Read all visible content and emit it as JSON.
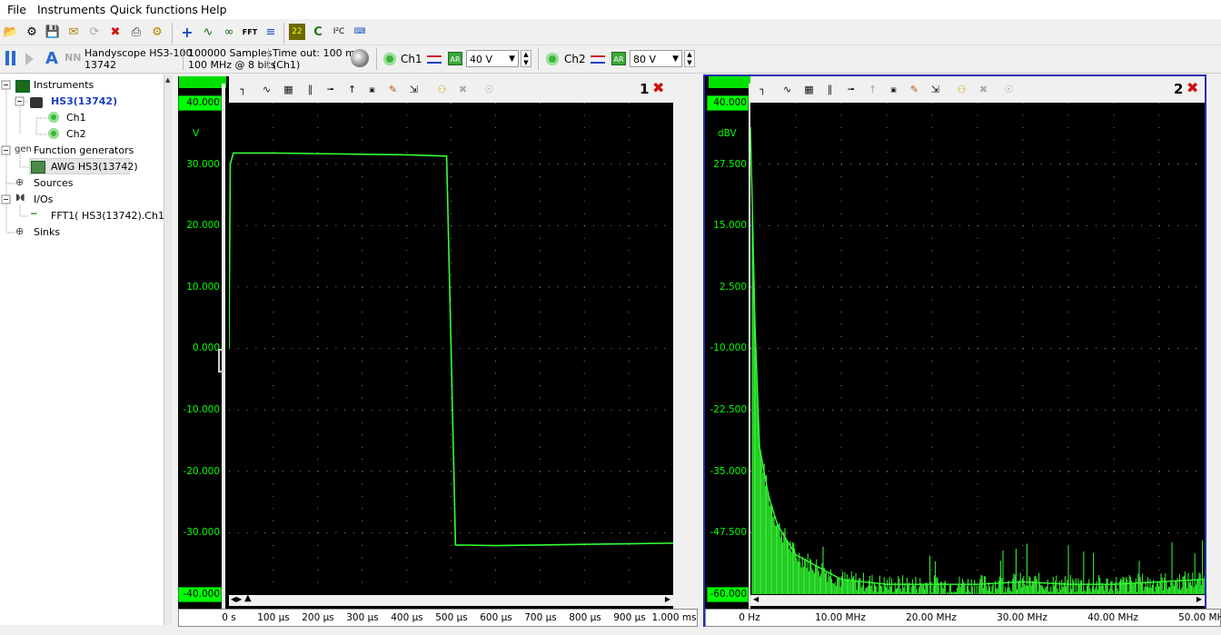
{
  "menu": [
    "File",
    "Instruments",
    "Quick functions",
    "Help"
  ],
  "instrument": {
    "name": "Handyscope HS3-100",
    "serial": "13742",
    "samples": "100000 Samples",
    "rate": "100 MHz @ 8 bits",
    "timeout": "Time out: 100 ms",
    "timeout_ch": "(Ch1)"
  },
  "ch1": {
    "label": "Ch1",
    "range": "40 V",
    "ar": "AR"
  },
  "ch2": {
    "label": "Ch2",
    "range": "80 V",
    "ar": "AR"
  },
  "tree": {
    "instruments": "Instruments",
    "device": "HS3(13742)",
    "ch1": "Ch1",
    "ch2": "Ch2",
    "funcgen": "Function generators",
    "awg": "AWG HS3(13742)",
    "sources": "Sources",
    "ios": "I/Os",
    "fft": "FFT1( HS3(13742).Ch1 )",
    "sinks": "Sinks"
  },
  "panel1": {
    "number": "1",
    "unit": "V",
    "yticks": [
      "40.000",
      "30.000",
      "20.000",
      "10.000",
      "0.000",
      "-10.000",
      "-20.000",
      "-30.000",
      "-40.000"
    ],
    "xticks": [
      "0 s",
      "100 µs",
      "200 µs",
      "300 µs",
      "400 µs",
      "500 µs",
      "600 µs",
      "700 µs",
      "800 µs",
      "900 µs",
      "1.000 ms"
    ]
  },
  "panel2": {
    "number": "2",
    "unit": "dBV",
    "yticks": [
      "40.000",
      "27.500",
      "15.000",
      "2.500",
      "-10.000",
      "-22.500",
      "-35.000",
      "-47.500",
      "-60.000"
    ],
    "xticks": [
      "0 Hz",
      "10.00 MHz",
      "20.00 MHz",
      "30.00 MHz",
      "40.00 MHz",
      "50.00 MHz"
    ]
  },
  "chart_data": [
    {
      "type": "line",
      "x": [
        0,
        3,
        10,
        100,
        200,
        300,
        400,
        490,
        500,
        510,
        600,
        700,
        800,
        900,
        1000
      ],
      "x_unit": "µs",
      "series": [
        {
          "values": [
            0,
            30,
            31.8,
            31.8,
            31.7,
            31.6,
            31.5,
            31.3,
            0,
            -32.0,
            -32.1,
            -32.0,
            -31.9,
            -31.8,
            -31.7
          ]
        }
      ],
      "ylim": [
        -40,
        40
      ],
      "xlim": [
        0,
        1000
      ],
      "ylabel": "V",
      "grid": true,
      "color": "#33ff33"
    },
    {
      "type": "line",
      "x": [
        0,
        0.2,
        0.5,
        1,
        2,
        3,
        5,
        8,
        10,
        15,
        20,
        25,
        30,
        35,
        40,
        45,
        50
      ],
      "x_unit": "MHz",
      "series": [
        {
          "values": [
            35,
            20,
            -5,
            -30,
            -40,
            -46,
            -52,
            -55,
            -57,
            -58,
            -58,
            -58,
            -57.5,
            -58,
            -58,
            -57.5,
            -57
          ]
        }
      ],
      "ylim": [
        -60,
        40
      ],
      "xlim": [
        0,
        50
      ],
      "ylabel": "dBV",
      "grid": true,
      "color": "#33ff33"
    }
  ]
}
